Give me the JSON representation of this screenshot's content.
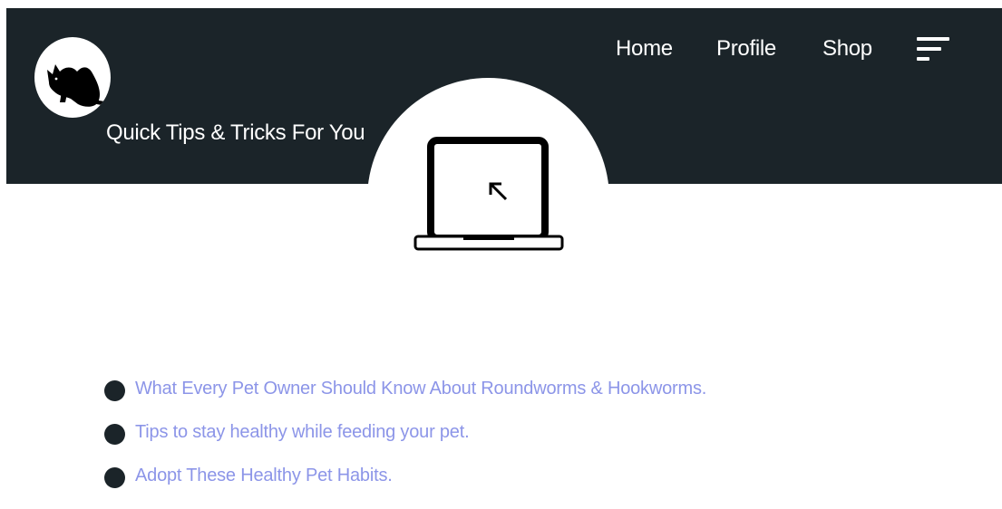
{
  "header": {
    "nav": [
      {
        "label": "Home"
      },
      {
        "label": "Profile"
      },
      {
        "label": "Shop"
      }
    ],
    "menu_icon": "hamburger-menu-icon",
    "logo_icon": "black-cat-logo",
    "background_color": "#1b2429"
  },
  "hero": {
    "title": "Quick Tips & Tricks For You",
    "icon": "laptop-cursor-icon"
  },
  "tips": {
    "link_color": "#8c95e8",
    "items": [
      {
        "label": "What Every Pet Owner Should Know About Roundworms & Hookworms."
      },
      {
        "label": "Tips to stay healthy while feeding your pet."
      },
      {
        "label": "Adopt These Healthy Pet Habits."
      }
    ]
  }
}
